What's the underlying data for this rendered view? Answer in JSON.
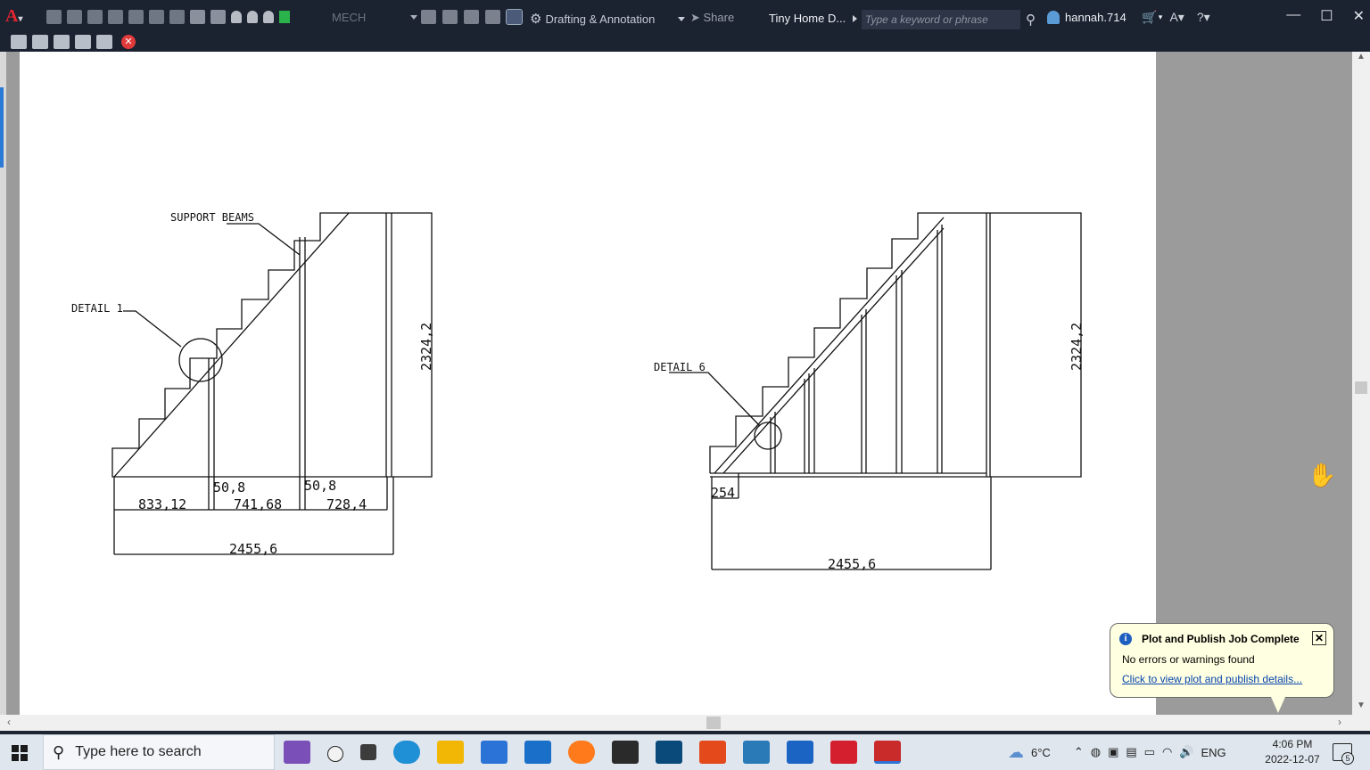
{
  "titlebar": {
    "layer": "MECH",
    "workspace": "Drafting & Annotation",
    "share": "Share",
    "document": "Tiny Home D...",
    "search_placeholder": "Type a keyword or phrase",
    "user": "hannah.714"
  },
  "drawing": {
    "left_stair": {
      "labels": [
        "SUPPORT BEAMS",
        "DETAIL 1"
      ],
      "dimensions": [
        "833,12",
        "50,8",
        "741,68",
        "50,8",
        "728,4",
        "2455,6",
        "2324,2"
      ]
    },
    "right_stair": {
      "labels": [
        "DETAIL 6"
      ],
      "dimensions": [
        "254",
        "2455,6",
        "2324,2"
      ]
    }
  },
  "notification": {
    "title": "Plot and Publish Job Complete",
    "message": "No errors or warnings found",
    "link": "Click to view plot and publish details..."
  },
  "taskbar": {
    "search_placeholder": "Type here to search",
    "weather": "6°C",
    "language": "ENG",
    "time": "4:06 PM",
    "date": "2022-12-07",
    "notification_count": "5"
  },
  "colors": {
    "titlebar_bg": "#1b2230",
    "paper": "#ffffff",
    "paper_surround": "#9b9b9b",
    "accent_red": "#e1252e"
  }
}
